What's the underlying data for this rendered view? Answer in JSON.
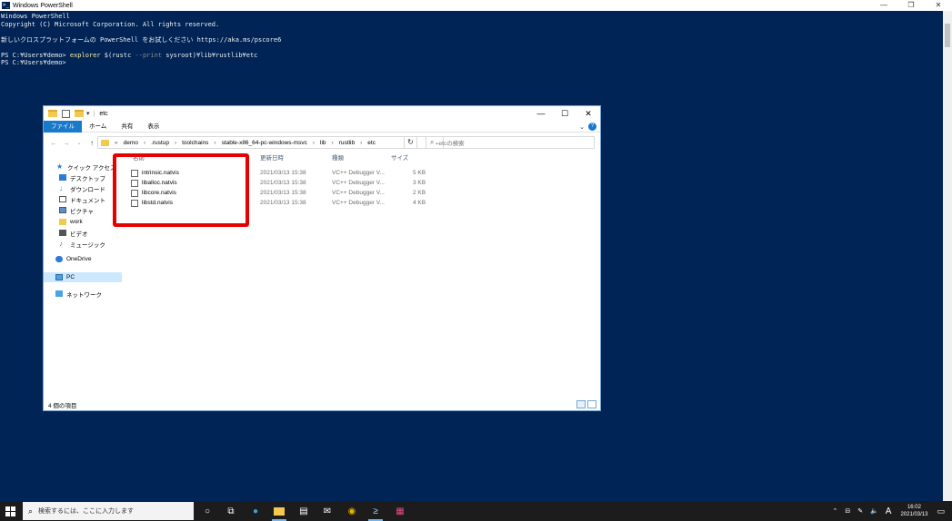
{
  "powershell": {
    "title": "Windows PowerShell",
    "lines": [
      "Windows PowerShell",
      "Copyright (C) Microsoft Corporation. All rights reserved.",
      "",
      "新しいクロスプラットフォームの PowerShell をお試しください https://aka.ms/pscore6",
      ""
    ],
    "prompt1": "PS C:¥Users¥demo> ",
    "cmd": "explorer",
    "arg1": " $(rustc ",
    "param": "--print",
    "arg2": " sysroot)¥lib¥rustlib¥etc",
    "prompt2": "PS C:¥Users¥demo>"
  },
  "explorer": {
    "title": "etc",
    "ribbon_tabs": [
      "ファイル",
      "ホーム",
      "共有",
      "表示"
    ],
    "address": {
      "prefix": "«",
      "crumbs": [
        "demo",
        ".rustup",
        "toolchains",
        "stable-x86_64-pc-windows-msvc",
        "lib",
        "rustlib",
        "etc"
      ]
    },
    "search_placeholder": "etcの検索",
    "nav": [
      {
        "label": "クイック アクセス",
        "icon": "star-icon"
      },
      {
        "label": "デスクトップ",
        "icon": "desktop-icon"
      },
      {
        "label": "ダウンロード",
        "icon": "download-icon"
      },
      {
        "label": "ドキュメント",
        "icon": "document-icon"
      },
      {
        "label": "ピクチャ",
        "icon": "picture-icon"
      },
      {
        "label": "work",
        "icon": "folder-icon"
      },
      {
        "label": "ビデオ",
        "icon": "video-icon"
      },
      {
        "label": "ミュージック",
        "icon": "music-icon"
      },
      {
        "label": "OneDrive",
        "icon": "cloud-icon"
      },
      {
        "label": "PC",
        "icon": "pc-icon"
      },
      {
        "label": "ネットワーク",
        "icon": "network-icon"
      }
    ],
    "columns": [
      "名前",
      "更新日時",
      "種類",
      "サイズ"
    ],
    "files": [
      {
        "name": "intrinsic.natvis",
        "date": "2021/03/13 15:38",
        "type": "VC++ Debugger V...",
        "size": "5 KB"
      },
      {
        "name": "liballoc.natvis",
        "date": "2021/03/13 15:38",
        "type": "VC++ Debugger V...",
        "size": "3 KB"
      },
      {
        "name": "libcore.natvis",
        "date": "2021/03/13 15:38",
        "type": "VC++ Debugger V...",
        "size": "2 KB"
      },
      {
        "name": "libstd.natvis",
        "date": "2021/03/13 15:38",
        "type": "VC++ Debugger V...",
        "size": "4 KB"
      }
    ],
    "status": "4 個の項目"
  },
  "taskbar": {
    "search_placeholder": "検索するには、ここに入力します",
    "time": "16:02",
    "date": "2021/03/13",
    "ime": "A"
  },
  "colors": {
    "console_bg": "#012456",
    "highlight": "#e60000",
    "accent": "#1979ca"
  }
}
